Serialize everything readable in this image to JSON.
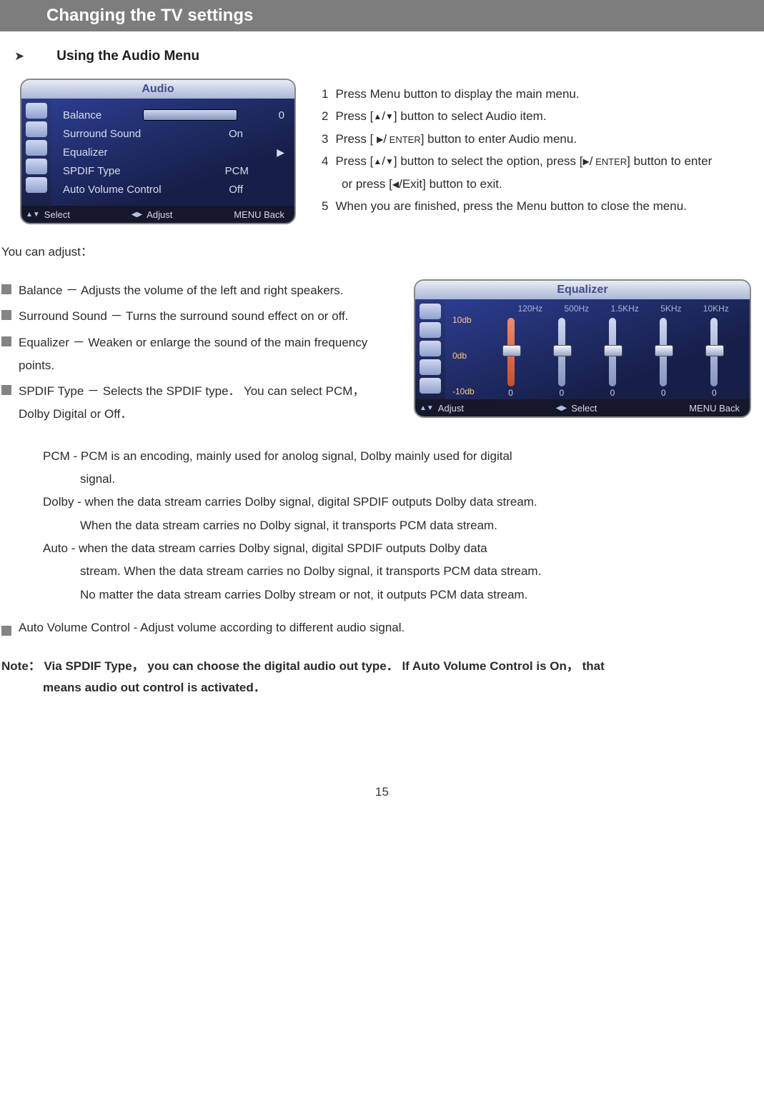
{
  "header": {
    "title": "Changing the TV settings"
  },
  "section": {
    "title": "Using the Audio Menu"
  },
  "audio_panel": {
    "title": "Audio",
    "rows": [
      {
        "label": "Balance",
        "value": "0",
        "type": "slider"
      },
      {
        "label": "Surround Sound",
        "value": "On"
      },
      {
        "label": "Equalizer",
        "value": "",
        "type": "submenu"
      },
      {
        "label": "SPDIF  Type",
        "value": "PCM"
      },
      {
        "label": "Auto Volume Control",
        "value": "Off"
      }
    ],
    "foot_select": "Select",
    "foot_adjust": "Adjust",
    "foot_back": "MENU  Back"
  },
  "instructions": {
    "i1": "Press Menu button to display the main menu.",
    "i2a": "Press [",
    "i2b": "] button to select Audio item.",
    "i3a": "Press [ ",
    "i3b": "] button to enter Audio menu.",
    "i4a": "Press [",
    "i4b": "] button to select the option, press [",
    "i4c": "] button to enter",
    "i4d": "or press [",
    "i4e": "/Exit] button to exit.",
    "i5": "When you are finished, press the Menu button to close the menu.",
    "enter": " ENTER",
    "slash": "/"
  },
  "you_can": "You can adjust：",
  "defs": {
    "balance": "Balance － Adjusts the volume of the left and right speakers.",
    "surround": "Surround Sound － Turns the surround sound effect on or off.",
    "equalizer": "Equalizer － Weaken or enlarge the sound of the main frequency points.",
    "spdif": "SPDIF Type － Selects the SPDIF type． You can select PCM，Dolby Digital or Off．"
  },
  "eq_panel": {
    "title": "Equalizer",
    "labels": [
      "10db",
      "0db",
      "-10db"
    ],
    "freqs": [
      "120Hz",
      "500Hz",
      "1.5KHz",
      "5KHz",
      "10KHz"
    ],
    "values": [
      "0",
      "0",
      "0",
      "0",
      "0"
    ],
    "foot_adjust": "Adjust",
    "foot_select": "Select",
    "foot_back": "MENU  Back"
  },
  "lower": {
    "pcm1": "PCM - PCM  is  an  encoding,   mainly  used  for  anolog  signal,   Dolby  mainly  used  for  digital",
    "pcm2": "signal.",
    "dolby1": "Dolby - when the data stream carries Dolby signal, digital SPDIF outputs Dolby data stream.",
    "dolby2": "When the data stream carries no Dolby signal, it transports PCM data stream.",
    "auto1": "Auto - when the data stream carries Dolby signal, digital SPDIF outputs Dolby data",
    "auto2": "stream. When the data stream carries no Dolby signal, it transports PCM data stream.",
    "auto3": "No matter the data stream carries Dolby stream or not, it outputs PCM data stream.",
    "avc": "Auto Volume Control    - Adjust volume according to different audio signal."
  },
  "note": {
    "label": "Note：",
    "l1": "Via SPDIF Type， you can choose the digital audio out type． If Auto Volume Control is On， that",
    "l2": "means audio out control is activated．"
  },
  "page_number": "15"
}
